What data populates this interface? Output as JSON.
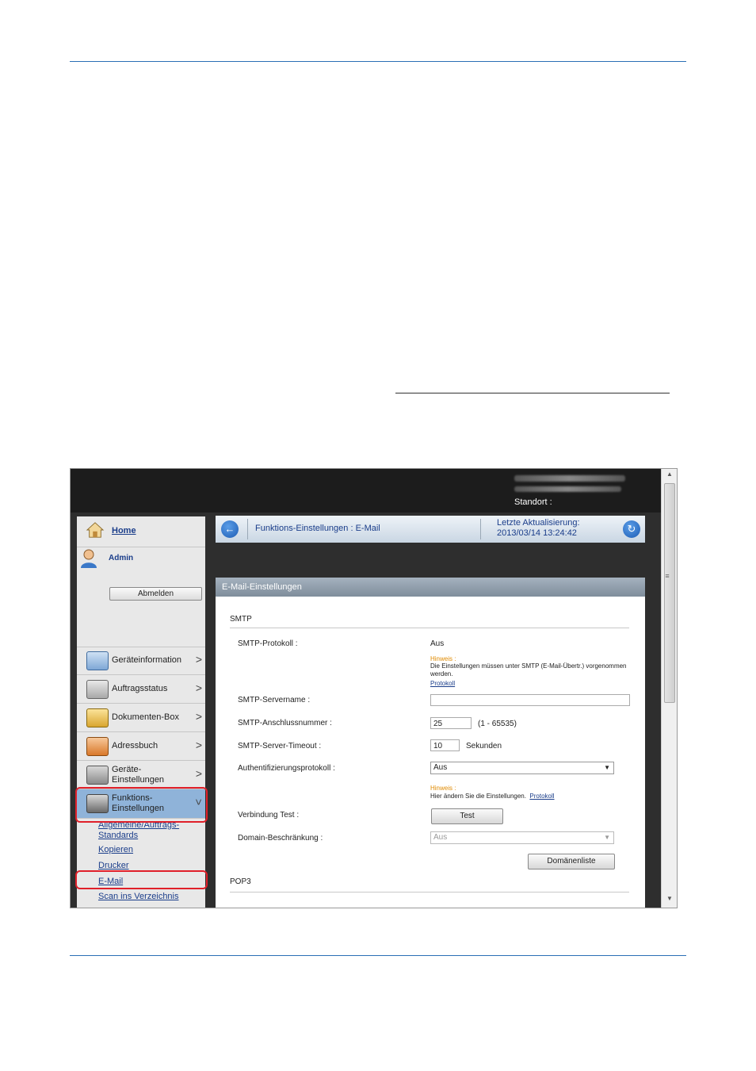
{
  "header": {
    "standort_label": "Standort :"
  },
  "sidebar": {
    "home": "Home",
    "user": "Admin",
    "logout": "Abmelden",
    "items": [
      {
        "label": "Geräteinformation",
        "icon": "device-info-icon"
      },
      {
        "label": "Auftragsstatus",
        "icon": "job-status-icon"
      },
      {
        "label": "Dokumenten-Box",
        "icon": "document-box-icon"
      },
      {
        "label": "Adressbuch",
        "icon": "address-book-icon"
      },
      {
        "label": "Geräte-\nEinstellungen",
        "icon": "device-settings-icon"
      },
      {
        "label": "Funktions-\nEinstellungen",
        "icon": "function-settings-icon"
      }
    ],
    "subitems": [
      "Allgemeine/Auftrags-\nStandards",
      "Kopieren",
      "Drucker",
      "E-Mail",
      "Scan ins Verzeichnis"
    ]
  },
  "navbar": {
    "title": "Funktions-Einstellungen : E-Mail",
    "last_update_label": "Letzte Aktualisierung:",
    "last_update_value": "2013/03/14 13:24:42"
  },
  "panel": {
    "title": "E-Mail-Einstellungen",
    "smtp_section": "SMTP",
    "smtp_protocol_label": "SMTP-Protokoll :",
    "smtp_protocol_value": "Aus",
    "hint_label": "Hinweis :",
    "hint_text": "Die Einstellungen müssen unter SMTP (E-Mail-Übertr.) vorgenommen werden.",
    "hint_link": "Protokoll",
    "server_name_label": "SMTP-Servername :",
    "server_name_value": "",
    "port_label": "SMTP-Anschlussnummer :",
    "port_value": "25",
    "port_range": "(1 - 65535)",
    "timeout_label": "SMTP-Server-Timeout :",
    "timeout_value": "10",
    "timeout_unit": "Sekunden",
    "auth_label": "Authentifizierungsprotokoll :",
    "auth_value": "Aus",
    "hint2_label": "Hinweis :",
    "hint2_text": "Hier ändern Sie die Einstellungen.",
    "hint2_link": "Protokoll",
    "conn_test_label": "Verbindung Test :",
    "conn_test_button": "Test",
    "domain_label": "Domain-Beschränkung :",
    "domain_value": "Aus",
    "domain_list_button": "Domänenliste",
    "pop3_section": "POP3"
  }
}
